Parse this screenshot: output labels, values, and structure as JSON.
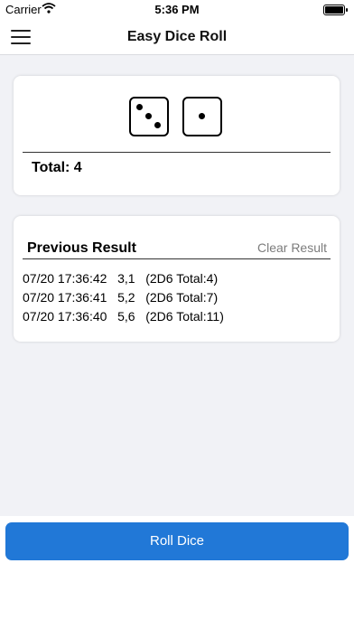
{
  "status_bar": {
    "carrier": "Carrier",
    "time": "5:36 PM"
  },
  "nav": {
    "title": "Easy Dice Roll",
    "menu_icon": "hamburger-menu-icon"
  },
  "dice": {
    "values": [
      3,
      1
    ],
    "total_label": "Total: 4"
  },
  "history": {
    "title": "Previous Result",
    "clear_label": "Clear Result",
    "rows": [
      "07/20 17:36:42   3,1   (2D6 Total:4)",
      "07/20 17:36:41   5,2   (2D6 Total:7)",
      "07/20 17:36:40   5,6   (2D6 Total:11)"
    ]
  },
  "roll_button": {
    "label": "Roll Dice"
  },
  "colors": {
    "accent": "#2178d7",
    "background": "#f1f2f6",
    "muted_text": "#7c7c7c"
  }
}
